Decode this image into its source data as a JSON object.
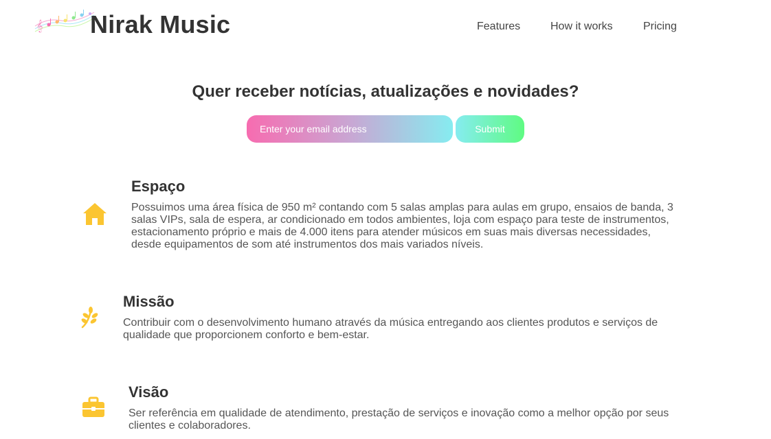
{
  "header": {
    "brand": "Nirak Music",
    "nav": [
      {
        "label": "Features"
      },
      {
        "label": "How it works"
      },
      {
        "label": "Pricing"
      }
    ]
  },
  "newsletter": {
    "title": "Quer receber notícias, atualizações e novidades?",
    "email_placeholder": "Enter your email address",
    "submit_label": "Submit"
  },
  "features": [
    {
      "icon": "home-icon",
      "title": "Espaço",
      "description": "Possuimos uma área física de 950 m² contando com 5 salas amplas para aulas em grupo, ensaios de banda, 3 salas VIPs, sala de espera, ar condicionado em todos ambientes, loja com espaço para teste de instrumentos, estacionamento próprio e mais de 4.000 itens para atender músicos em suas mais diversas necessidades, desde equipamentos de som até instrumentos dos mais variados níveis."
    },
    {
      "icon": "seedling-icon",
      "title": "Missão",
      "description": "Contribuir com o desenvolvimento humano através da música entregando aos clientes produtos e serviços de qualidade que proporcionem conforto e bem-estar."
    },
    {
      "icon": "briefcase-icon",
      "title": "Visão",
      "description": "Ser referência em qualidade de atendimento, prestação de serviços e inovação como a melhor opção por seus clientes e colaboradores."
    }
  ],
  "colors": {
    "icon": "#fbc531",
    "input_gradient": [
      "#f76cb0",
      "#86ecf0"
    ],
    "button_gradient": [
      "#86ecf0",
      "#5ffb82"
    ]
  }
}
